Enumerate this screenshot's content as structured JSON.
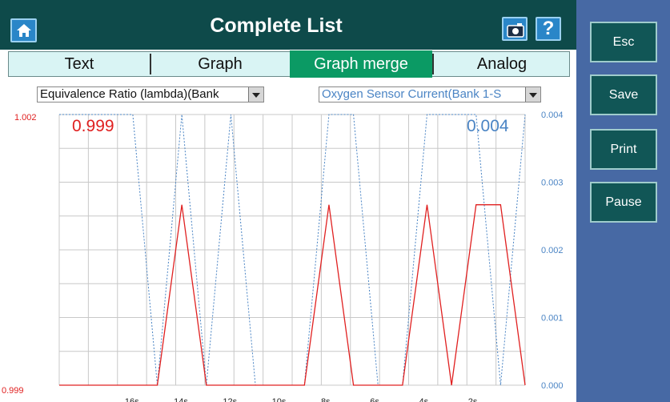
{
  "header": {
    "title": "Complete List",
    "help_label": "?"
  },
  "tabs": [
    {
      "label": "Text",
      "active": false
    },
    {
      "label": "Graph",
      "active": false
    },
    {
      "label": "Graph merge",
      "active": true
    },
    {
      "label": "Analog",
      "active": false
    }
  ],
  "left_select": {
    "value": "Equivalence Ratio (lambda)(Bank"
  },
  "right_select": {
    "value": "Oxygen Sensor Current(Bank 1-S"
  },
  "sidebar": {
    "esc_label": "Esc",
    "save_label": "Save",
    "print_label": "Print",
    "pause_label": "Pause"
  },
  "colors": {
    "titlebar": "#0e4a4a",
    "sidebar": "#4769a4",
    "tab_active": "#0b9a64",
    "series1": "#e02020",
    "series2": "#4a84c4"
  },
  "chart_data": {
    "type": "line",
    "x_unit": "s",
    "x_ticks": [
      "16s",
      "14s",
      "12s",
      "10s",
      "8s",
      "6s",
      "4s",
      "2s"
    ],
    "left_axis": {
      "min_label": "0.999",
      "max_label": "1.002",
      "ylim": [
        0.999,
        1.002
      ]
    },
    "right_axis": {
      "tick_labels": [
        "0.004",
        "0.003",
        "0.002",
        "0.001",
        "0.000"
      ],
      "ylim": [
        0.0,
        0.004
      ]
    },
    "series": [
      {
        "axis": "left",
        "style": "solid",
        "color": "#e02020",
        "current_value": "0.999",
        "x": [
          19,
          18,
          17,
          16,
          15,
          14,
          13,
          12,
          11,
          10,
          9,
          8,
          7,
          6,
          5,
          4,
          3,
          2,
          1,
          0
        ],
        "y": [
          0.999,
          0.999,
          0.999,
          0.999,
          0.999,
          1.001,
          0.999,
          0.999,
          0.999,
          0.999,
          0.999,
          1.001,
          0.999,
          0.999,
          0.999,
          1.001,
          0.999,
          1.001,
          1.001,
          0.999
        ]
      },
      {
        "axis": "right",
        "style": "dotted",
        "color": "#4a84c4",
        "current_value": "0.004",
        "x": [
          19,
          18,
          17,
          16,
          15,
          14,
          13,
          12,
          11,
          10,
          9,
          8,
          7,
          6,
          5,
          4,
          3,
          2,
          1,
          0
        ],
        "y": [
          0.004,
          0.004,
          0.004,
          0.004,
          0.0,
          0.004,
          0.0,
          0.004,
          0.0,
          0.0,
          0.0,
          0.004,
          0.004,
          0.0,
          0.0,
          0.004,
          0.004,
          0.004,
          0.0,
          0.004
        ]
      }
    ]
  }
}
